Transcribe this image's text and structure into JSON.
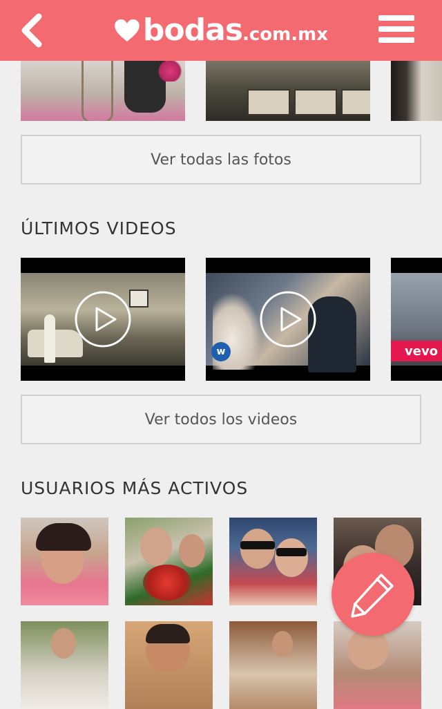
{
  "header": {
    "brand": "bodas",
    "brand_suffix": ".com.mx",
    "back_icon": "chevron-left-icon",
    "menu_icon": "hamburger-menu-icon",
    "color": "#f46a71"
  },
  "photos": {
    "button_label": "Ver todas las fotos"
  },
  "videos": {
    "section_title": "ÚLTIMOS VIDEOS",
    "button_label": "Ver todos los videos",
    "items": [
      {
        "play_icon": "play-icon"
      },
      {
        "play_icon": "play-icon",
        "badge": "w"
      },
      {
        "badge": "vevo"
      }
    ]
  },
  "users": {
    "section_title": "USUARIOS MÁS ACTIVOS"
  },
  "fab": {
    "icon": "pencil-icon"
  }
}
